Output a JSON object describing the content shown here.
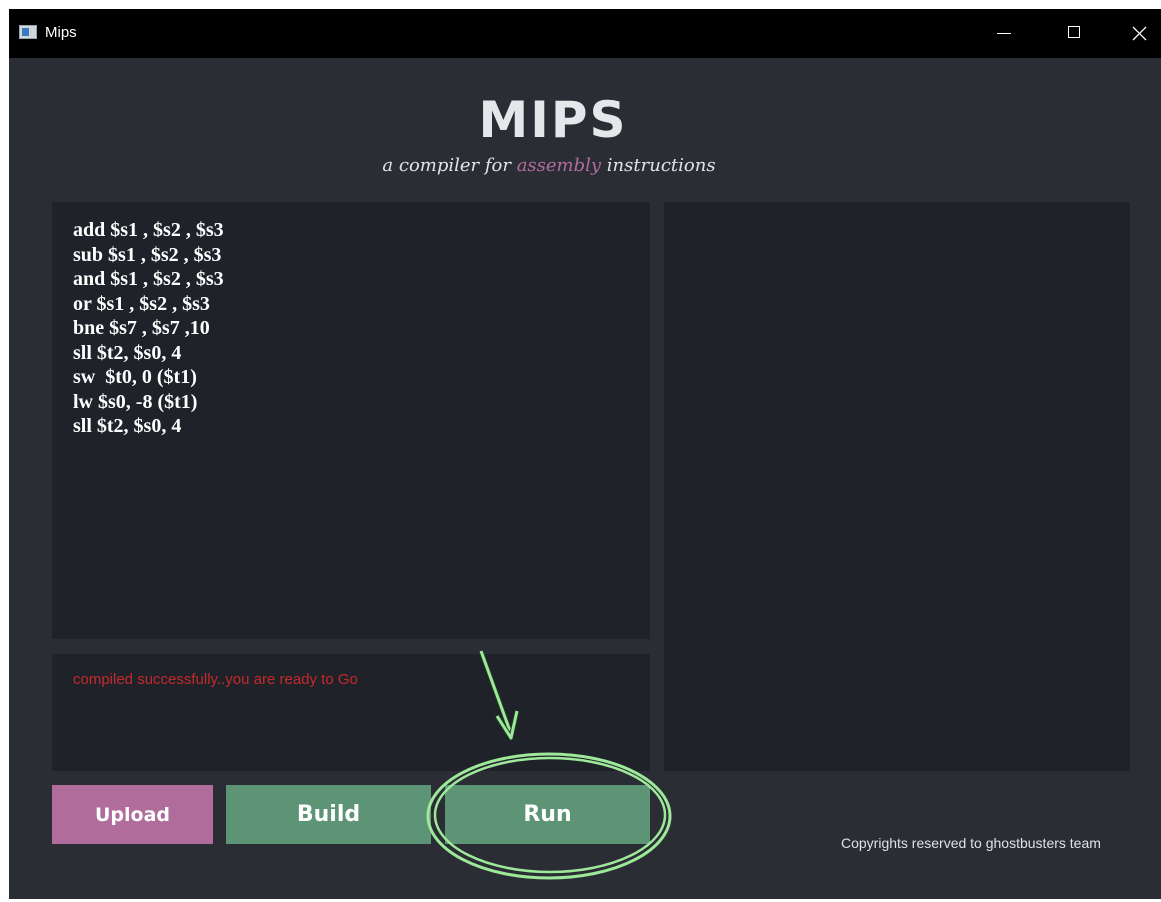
{
  "window": {
    "title": "Mips",
    "controls": {
      "minimize": "minimize",
      "maximize": "maximize",
      "close": "close"
    }
  },
  "header": {
    "title": "MIPS",
    "subtitle_before": "a compiler for ",
    "subtitle_accent": "assembly",
    "subtitle_after": "  instructions"
  },
  "editor": {
    "lines": [
      "add $s1 , $s2 , $s3",
      "sub $s1 , $s2 , $s3",
      "and $s1 , $s2 , $s3",
      "or $s1 , $s2 , $s3",
      "bne $s7 , $s7 ,10",
      "sll $t2, $s0, 4",
      "sw  $t0, 0 ($t1)",
      "lw $s0, -8 ($t1)",
      "sll $t2, $s0, 4"
    ]
  },
  "console": {
    "message": "compiled successfully..you are ready to Go"
  },
  "buttons": {
    "upload": "Upload",
    "build": "Build",
    "run": "Run"
  },
  "footer": {
    "copyright": "Copyrights reserved to ghostbusters team"
  },
  "colors": {
    "window_bg": "#2b2d34",
    "panel_bg": "#20222a",
    "upload_btn": "#b06d9c",
    "action_btn": "#5e9476",
    "accent_text": "#b06d9c",
    "console_text": "#c42a2a",
    "annotation": "#9ee89a"
  }
}
